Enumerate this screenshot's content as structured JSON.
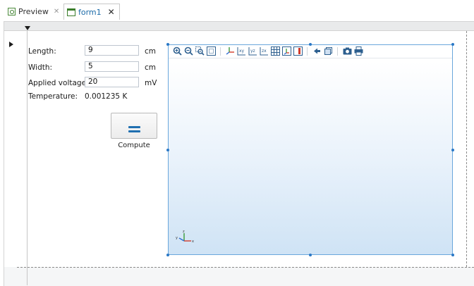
{
  "tabs": [
    {
      "label": "Preview",
      "close": "✕"
    },
    {
      "label": "form1",
      "close": "✕"
    }
  ],
  "form": {
    "length": {
      "label": "Length:",
      "value": "9",
      "unit": "cm"
    },
    "width": {
      "label": "Width:",
      "value": "5",
      "unit": "cm"
    },
    "voltage": {
      "label": "Applied voltage:",
      "value": "20",
      "unit": "mV"
    },
    "temperature": {
      "label": "Temperature:",
      "value": "0.001235 K"
    },
    "compute_label": "Compute"
  },
  "graphics": {
    "toolbar_icons": [
      "zoom-in-icon",
      "zoom-out-icon",
      "zoom-box-icon",
      "zoom-extents-icon",
      "default-view-icon",
      "xy-view-icon",
      "yz-view-icon",
      "zx-view-icon",
      "grid-icon",
      "axis-orientation-icon",
      "color-legend-icon",
      "transparency-icon",
      "wireframe-icon",
      "camera-icon",
      "print-icon"
    ],
    "axis_labels": {
      "x": "x",
      "y": "y",
      "z": "z"
    }
  },
  "colors": {
    "accent": "#1f6fb0",
    "selection_border": "#6aa7dc",
    "tab_active_text": "#1a6aa8"
  }
}
